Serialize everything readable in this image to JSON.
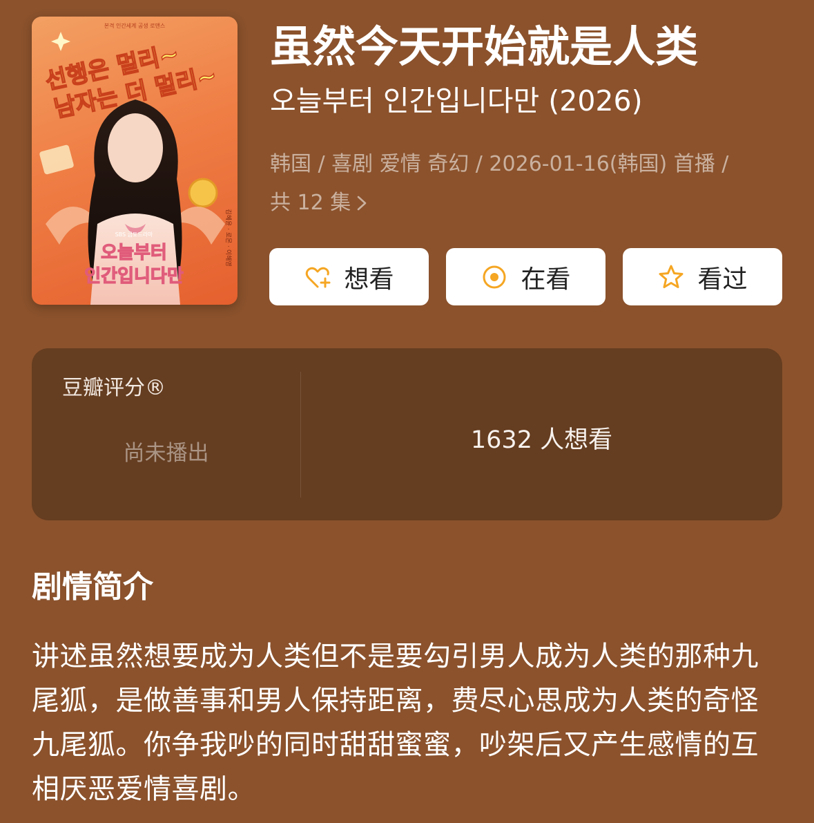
{
  "poster": {
    "top_caption": "본격 인간세계 공생 로맨스",
    "tagline_line1": "선행은 멀리~",
    "tagline_line2": "남자는 더 멀리~",
    "network": "SBS 금토드라마",
    "logo_line1": "오늘부터",
    "logo_line2": "인간입니다만",
    "side_credits": "김혜윤 · 로몬 · 이해영"
  },
  "title": "虽然今天开始就是人类",
  "subtitle": "오늘부터 인간입니다만 (2026)",
  "meta": {
    "line1": "韩国 / 喜剧 爱情 奇幻 / 2026-01-16(韩国) 首播 /",
    "line2": "共 12 集"
  },
  "buttons": {
    "want": "想看",
    "watching": "在看",
    "watched": "看过"
  },
  "icons": {
    "want": "heart-plus-icon",
    "watching": "target-circle-icon",
    "watched": "star-outline-icon",
    "chevron": "chevron-right-icon",
    "accent_color": "#f5a623"
  },
  "rating": {
    "label": "豆瓣评分®",
    "value": "尚未播出",
    "want_count": "1632 人想看"
  },
  "synopsis": {
    "title": "剧情简介",
    "text": "讲述虽然想要成为人类但不是要勾引男人成为人类的那种九尾狐，是做善事和男人保持距离，费尽心思成为人类的奇怪九尾狐。你争我吵的同时甜甜蜜蜜，吵架后又产生感情的互相厌恶爱情喜剧。"
  }
}
